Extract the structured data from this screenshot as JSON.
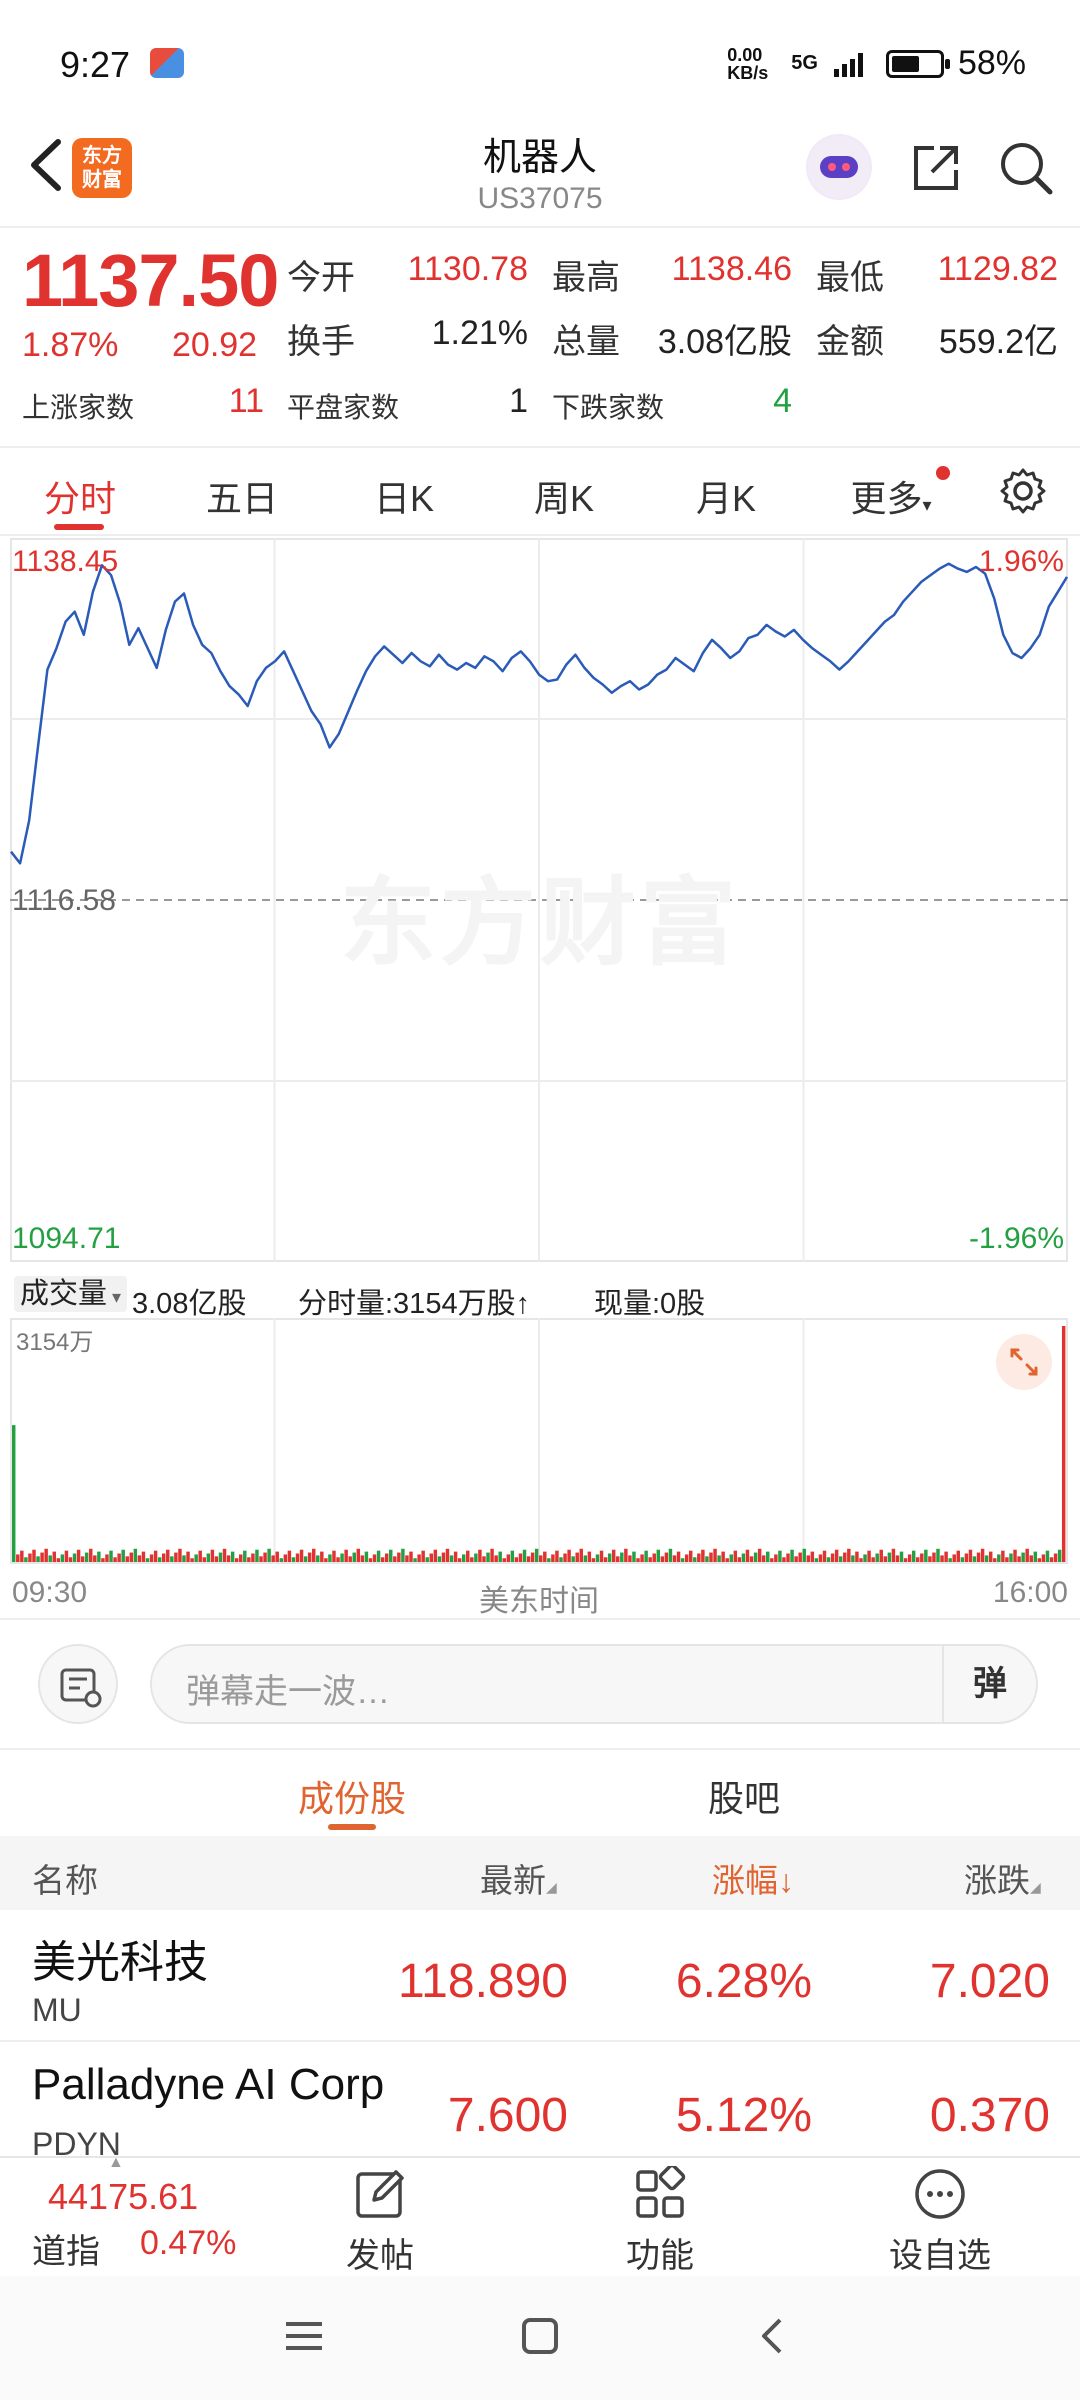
{
  "status_bar": {
    "time": "9:27",
    "net_speed": "0.00 KB/s",
    "network": "5G",
    "battery": "58%",
    "battery_level": 0.58
  },
  "header": {
    "back_icon": "chevron-left-icon",
    "logo_text_line1": "东方",
    "logo_text_line2": "财富",
    "title": "机器人",
    "code": "US37075",
    "avatar_icon": "robot-avatar-icon",
    "share_icon": "share-icon",
    "search_icon": "search-icon"
  },
  "quote": {
    "price": "1137.50",
    "change_pct": "1.87%",
    "change_value": "20.92",
    "open_label": "今开",
    "open": "1130.78",
    "high_label": "最高",
    "high": "1138.46",
    "low_label": "最低",
    "low": "1129.82",
    "turnover_label": "换手",
    "turnover": "1.21%",
    "volume_label": "总量",
    "volume": "3.08亿股",
    "amount_label": "金额",
    "amount": "559.2亿",
    "up_label": "上涨家数",
    "up_count": "11",
    "flat_label": "平盘家数",
    "flat_count": "1",
    "down_label": "下跌家数",
    "down_count": "4"
  },
  "period_tabs": [
    "分时",
    "五日",
    "日K",
    "周K",
    "月K",
    "更多"
  ],
  "chart_labels": {
    "top_price": "1138.45",
    "mid_price": "1116.58",
    "bottom_price": "1094.71",
    "top_pct": "1.96%",
    "bottom_pct": "-1.96%",
    "watermark": "东方财富",
    "vol_selector": "成交量",
    "vol_total": "3.08亿股",
    "vol_minute": "分时量:3154万股↑",
    "vol_now": "现量:0股",
    "vol_max": "3154万",
    "time_start": "09:30",
    "time_mid": "美东时间",
    "time_end": "16:00"
  },
  "chart_data": {
    "type": "line",
    "xlabel": "",
    "ylabel": "",
    "ylim": [
      1094.71,
      1138.45
    ],
    "series": [
      {
        "values": [
          1119.5,
          1118.8,
          1121.4,
          1126.0,
          1130.5,
          1131.8,
          1133.4,
          1134.0,
          1132.6,
          1135.2,
          1136.8,
          1136.2,
          1134.5,
          1132.0,
          1133.0,
          1131.8,
          1130.6,
          1132.9,
          1134.6,
          1135.1,
          1133.2,
          1132.0,
          1131.5,
          1130.4,
          1129.5,
          1129.0,
          1128.3,
          1129.8,
          1130.6,
          1131.0,
          1131.6,
          1130.4,
          1129.2,
          1128.0,
          1127.2,
          1125.8,
          1126.6,
          1127.9,
          1129.2,
          1130.4,
          1131.3,
          1131.9,
          1131.4,
          1130.9,
          1131.5,
          1131.0,
          1130.7,
          1131.4,
          1130.8,
          1130.5,
          1130.9,
          1130.6,
          1131.3,
          1131.0,
          1130.4,
          1131.2,
          1131.6,
          1131.0,
          1130.2,
          1129.8,
          1129.9,
          1130.8,
          1131.4,
          1130.6,
          1130.0,
          1129.6,
          1129.1,
          1129.5,
          1129.8,
          1129.3,
          1129.6,
          1130.2,
          1130.5,
          1131.2,
          1130.8,
          1130.4,
          1131.5,
          1132.3,
          1131.8,
          1131.2,
          1131.6,
          1132.4,
          1132.6,
          1133.2,
          1132.8,
          1132.5,
          1132.9,
          1132.3,
          1131.8,
          1131.4,
          1131.0,
          1130.5,
          1131.0,
          1131.6,
          1132.2,
          1132.8,
          1133.4,
          1133.8,
          1134.6,
          1135.2,
          1135.8,
          1136.2,
          1136.6,
          1136.9,
          1136.6,
          1136.4,
          1136.7,
          1136.3,
          1134.8,
          1132.6,
          1131.5,
          1131.2,
          1131.8,
          1132.6,
          1134.3,
          1135.2,
          1136.1
        ],
        "color": "#2b5bb8"
      }
    ],
    "volume": {
      "max_label": "3154万",
      "open_spike": 0.58,
      "close_spike": 1.0,
      "typical": 0.04
    },
    "grid": true
  },
  "danmaku": {
    "placeholder": "弹幕走一波…",
    "send_label": "弹"
  },
  "sub_tabs": {
    "components": "成份股",
    "guba": "股吧"
  },
  "table": {
    "col_name": "名称",
    "col_latest": "最新",
    "col_pct": "涨幅",
    "col_change": "涨跌",
    "rows": [
      {
        "name": "美光科技",
        "code": "MU",
        "latest": "118.890",
        "pct": "6.28%",
        "change": "7.020"
      },
      {
        "name": "Palladyne AI Corp",
        "code": "PDYN",
        "latest": "7.600",
        "pct": "5.12%",
        "change": "0.370"
      }
    ]
  },
  "bottom_bar": {
    "index_value": "44175.61",
    "index_name": "道指",
    "index_pct": "0.47%",
    "post_label": "发帖",
    "func_label": "功能",
    "watch_label": "设自选"
  },
  "colors": {
    "up": "#e0332f",
    "down": "#23a042",
    "line": "#2b5bb8",
    "accent": "#e0642f"
  }
}
